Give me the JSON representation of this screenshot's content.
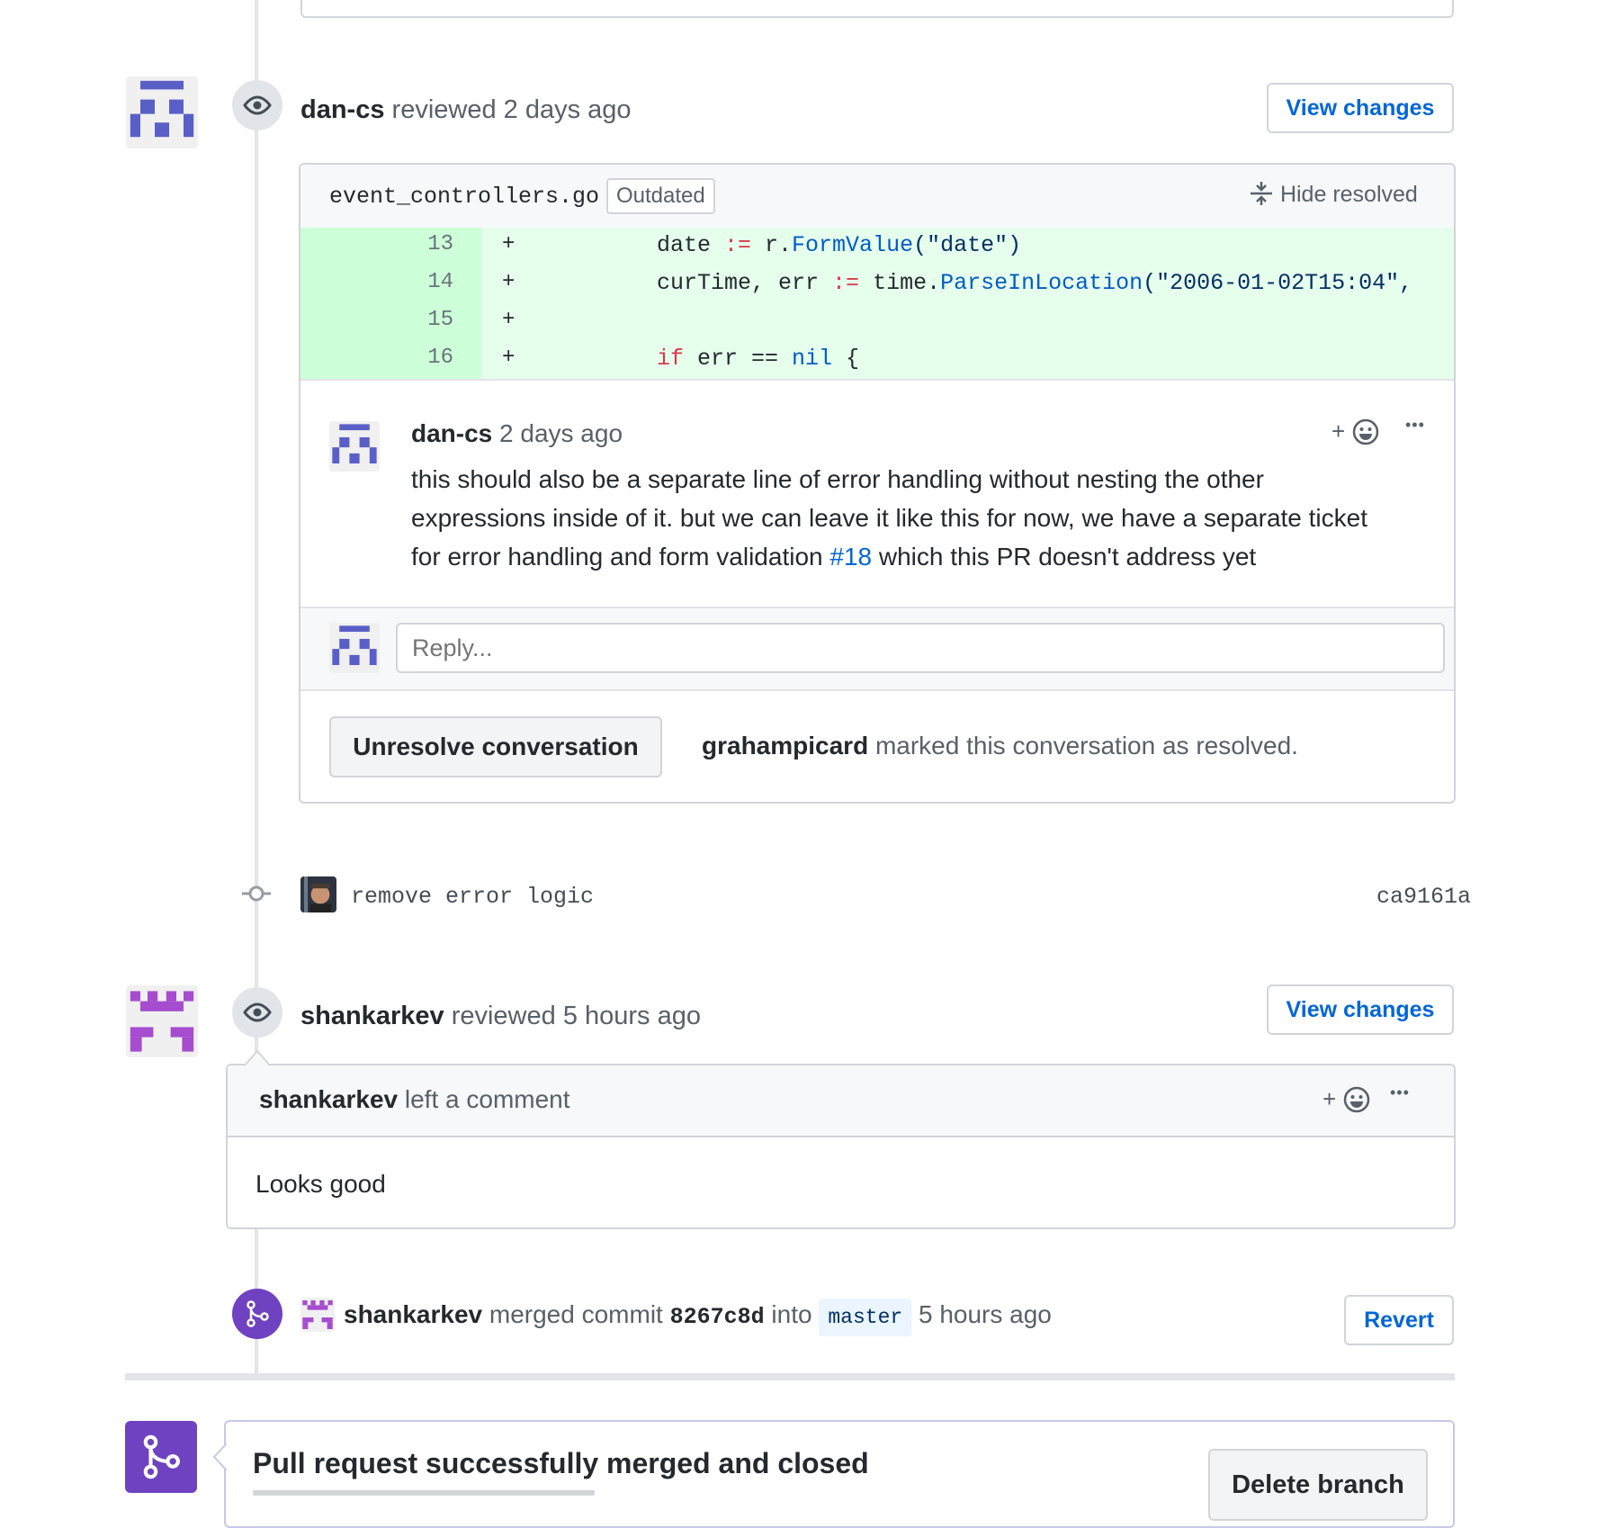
{
  "review1": {
    "user": "dan-cs",
    "action": "reviewed",
    "time": "2 days ago",
    "view_changes": "View changes",
    "file": {
      "name": "event_controllers.go",
      "badge": "Outdated",
      "hide_resolved": "Hide resolved"
    },
    "diff": [
      {
        "num": "13",
        "sign": "+"
      },
      {
        "num": "14",
        "sign": "+"
      },
      {
        "num": "15",
        "sign": "+"
      },
      {
        "num": "16",
        "sign": "+"
      }
    ],
    "code": {
      "l13_a": "date ",
      "l13_op": ":=",
      "l13_b": " r.",
      "l13_fn": "FormValue",
      "l13_c": "(\"date\")",
      "l14_a": "curTime, err ",
      "l14_op": ":=",
      "l14_b": " time.",
      "l14_fn": "ParseInLocation",
      "l14_c": "(\"2006-01-02T15:04\",",
      "l16_kw": "if",
      "l16_a": " err == ",
      "l16_nil": "nil",
      "l16_b": " {"
    },
    "comment": {
      "user": "dan-cs",
      "time": "2 days ago",
      "add_reaction": "+",
      "more": "•••",
      "body_1": "this should also be a separate line of error handling without nesting the other",
      "body_2": "expressions inside of it. but we can leave it like this for now, we have a separate ticket",
      "body_3a": "for error handling and form validation ",
      "body_link": "#18",
      "body_3b": " which this PR doesn't address yet"
    },
    "reply_placeholder": "Reply...",
    "unresolve_label": "Unresolve conversation",
    "resolved_by": "grahampicard",
    "resolved_text": " marked this conversation as resolved."
  },
  "commit": {
    "message": "remove error logic",
    "sha": "ca9161a"
  },
  "review2": {
    "user": "shankarkev",
    "action": "reviewed",
    "time": "5 hours ago",
    "view_changes": "View changes",
    "comment_header_user": "shankarkev",
    "comment_header_text": "left a comment",
    "add_reaction": "+",
    "more": "•••",
    "body": "Looks good"
  },
  "merge": {
    "user": "shankarkev",
    "text1": "merged commit",
    "sha": "8267c8d",
    "text2": "into",
    "branch": "master",
    "time": "5 hours ago",
    "revert": "Revert"
  },
  "merged_box": {
    "title": "Pull request successfully merged and closed",
    "delete_branch": "Delete branch"
  },
  "colors": {
    "accent": "#0366d6",
    "merged_purple": "#6f42c1",
    "diff_add_bg": "#e6ffed",
    "diff_num_bg": "#cdffd8",
    "avatar_blue": "#5a5fc8",
    "avatar_purple": "#a64ccf"
  }
}
